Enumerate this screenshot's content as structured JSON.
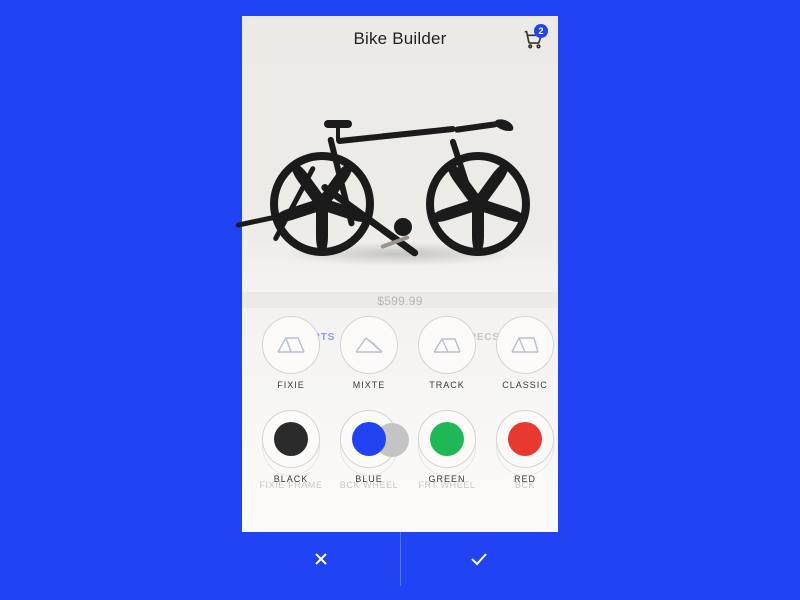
{
  "header": {
    "title": "Bike Builder",
    "cart_count": "2"
  },
  "price": "$599.99",
  "tabs_ghost": {
    "parts": "PARTS",
    "specs": "SPECS"
  },
  "frame_options": [
    {
      "label": "FIXIE"
    },
    {
      "label": "MIXTE"
    },
    {
      "label": "TRACK"
    },
    {
      "label": "CLASSIC"
    }
  ],
  "color_options": [
    {
      "label": "BLACK",
      "hex": "#2b2b2b"
    },
    {
      "label": "BLUE",
      "hex": "#2043F3"
    },
    {
      "label": "GREEN",
      "hex": "#1EB955"
    },
    {
      "label": "RED",
      "hex": "#E8382F"
    }
  ],
  "ghost_parts": [
    {
      "label": "FIXIE FRAME"
    },
    {
      "label": "BCK WHEEL"
    },
    {
      "label": "FRT WHEEL"
    },
    {
      "label": "BCK"
    }
  ],
  "actions": {
    "cancel": "Cancel",
    "confirm": "Confirm"
  }
}
